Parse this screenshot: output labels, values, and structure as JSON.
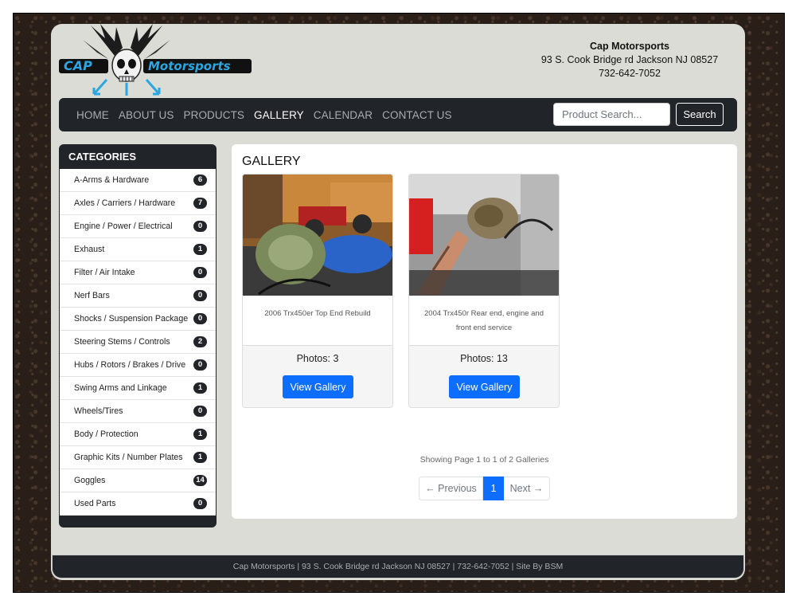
{
  "header": {
    "logo_text_left": "CAP",
    "logo_text_right": "Motorsports",
    "contact": {
      "name": "Cap Motorsports",
      "address": "93 S. Cook Bridge rd Jackson NJ 08527",
      "phone": "732-642-7052"
    }
  },
  "nav": {
    "items": [
      "HOME",
      "ABOUT US",
      "PRODUCTS",
      "GALLERY",
      "CALENDAR",
      "CONTACT US"
    ],
    "active": "GALLERY",
    "search_placeholder": "Product Search...",
    "search_button": "Search"
  },
  "sidebar": {
    "title": "CATEGORIES",
    "categories": [
      {
        "label": "A-Arms & Hardware",
        "count": "6"
      },
      {
        "label": "Axles / Carriers / Hardware",
        "count": "7"
      },
      {
        "label": "Engine / Power / Electrical",
        "count": "0"
      },
      {
        "label": "Exhaust",
        "count": "1"
      },
      {
        "label": "Filter / Air Intake",
        "count": "0"
      },
      {
        "label": "Nerf Bars",
        "count": "0"
      },
      {
        "label": "Shocks / Suspension Package",
        "count": "0"
      },
      {
        "label": "Steering Stems / Controls",
        "count": "2"
      },
      {
        "label": "Hubs / Rotors / Brakes / Drive",
        "count": "0"
      },
      {
        "label": "Swing Arms and Linkage",
        "count": "1"
      },
      {
        "label": "Wheels/Tires",
        "count": "0"
      },
      {
        "label": "Body / Protection",
        "count": "1"
      },
      {
        "label": "Graphic Kits / Number Plates",
        "count": "1"
      },
      {
        "label": "Goggles",
        "count": "14"
      },
      {
        "label": "Used Parts",
        "count": "0"
      }
    ]
  },
  "main": {
    "title": "GALLERY",
    "galleries": [
      {
        "caption": "2006 Trx450er Top End Rebuild",
        "photos": "Photos: 3",
        "button": "View Gallery"
      },
      {
        "caption": "2004 Trx450r Rear end, engine and front end service",
        "photos": "Photos: 13",
        "button": "View Gallery"
      }
    ],
    "showing": "Showing Page 1 to 1 of 2 Galleries",
    "pagination": {
      "prev": "← Previous",
      "current": "1",
      "next": "Next →"
    }
  },
  "footer": {
    "text": "Cap Motorsports | 93 S. Cook Bridge rd Jackson NJ 08527 | 732-642-7052 | Site By BSM"
  },
  "colors": {
    "primary": "#0d6efd",
    "dark": "#212529",
    "page_bg": "#dcdcd6",
    "logo_blue": "#2aa6e0"
  }
}
